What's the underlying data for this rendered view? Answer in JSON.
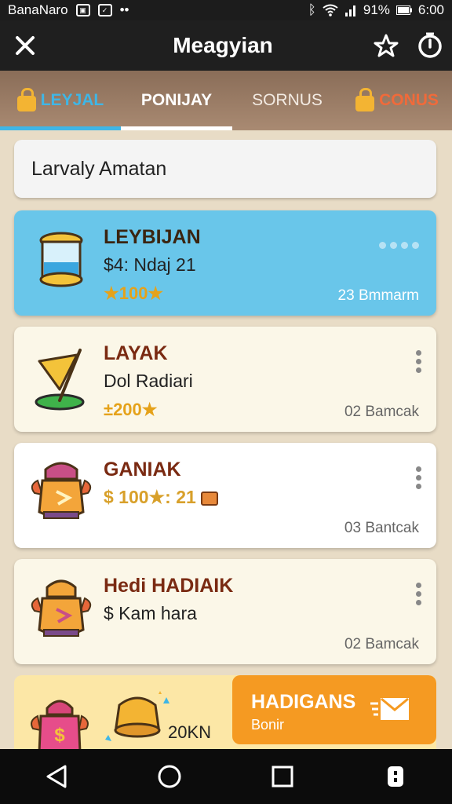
{
  "status": {
    "carrier": "BanaNaro",
    "dots": "••",
    "battery": "91%",
    "time": "6:00"
  },
  "appbar": {
    "title": "Meagyian"
  },
  "tabs": [
    {
      "label": "LEYJAL",
      "active": true
    },
    {
      "label": "PONIJAY"
    },
    {
      "label": "SORNUS"
    },
    {
      "label": "CONUS"
    }
  ],
  "search": {
    "value": "Larvaly Amatan"
  },
  "cards": [
    {
      "name": "LEYBIJAN",
      "sub": "$4: Ndaj 21",
      "points": "★100★",
      "meta": "23 Bmmarm"
    },
    {
      "name": "LAYAK",
      "sub": "Dol Radiari",
      "points": "±200★",
      "meta": "02 Bamcak"
    },
    {
      "name": "GANIAK",
      "sub": "$ 100★: 21",
      "meta": "03 Bantcak"
    },
    {
      "name": "Hedi HADIAIK",
      "sub": "$ Kam hara",
      "meta": "02 Bamcak"
    }
  ],
  "promo": {
    "amount": "20KN",
    "cta_title": "HADIGANS",
    "cta_sub": "Bonir"
  },
  "colors": {
    "accent_blue": "#3fb6e6",
    "accent_orange": "#f59a22",
    "coral": "#f06a3a"
  }
}
